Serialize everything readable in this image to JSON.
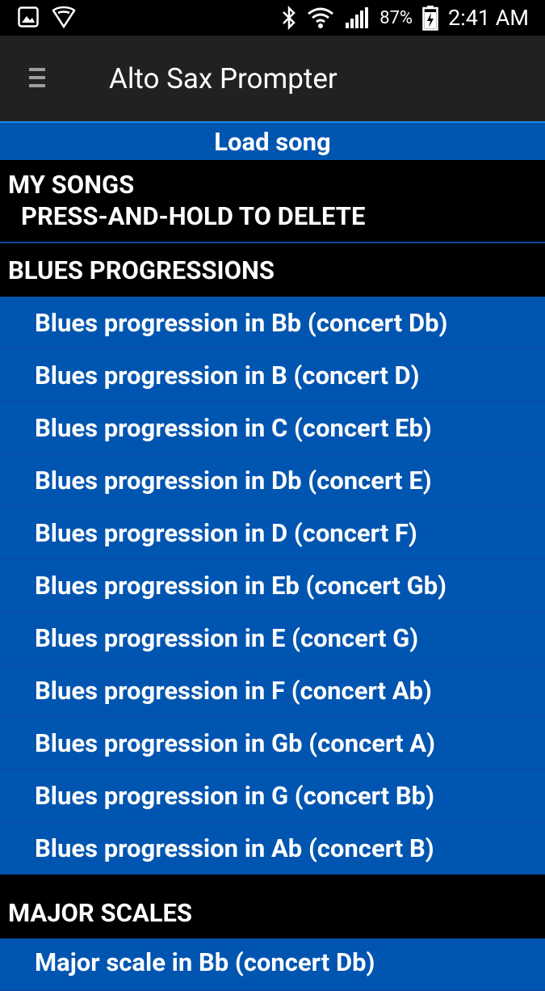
{
  "status_bar": {
    "battery_percent": "87%",
    "time": "2:41 AM"
  },
  "app_bar": {
    "title": "Alto Sax Prompter"
  },
  "load_bar": {
    "label": "Load song"
  },
  "groups": {
    "my_songs": {
      "title": "MY SONGS",
      "subtitle": "PRESS-AND-HOLD TO DELETE"
    },
    "blues": {
      "title": "BLUES PROGRESSIONS",
      "items": [
        "Blues progression in Bb (concert Db)",
        "Blues progression in B (concert D)",
        "Blues progression in C (concert Eb)",
        "Blues progression in Db (concert E)",
        "Blues progression in D (concert F)",
        "Blues progression in Eb (concert Gb)",
        "Blues progression in E (concert G)",
        "Blues progression in F (concert Ab)",
        "Blues progression in Gb (concert A)",
        "Blues progression in G (concert Bb)",
        "Blues progression in Ab (concert B)"
      ]
    },
    "major": {
      "title": "MAJOR SCALES",
      "items": [
        "Major scale in Bb (concert Db)"
      ]
    }
  },
  "colors": {
    "primary_blue": "#0055b0",
    "app_bar": "#212121",
    "background": "#000000"
  }
}
